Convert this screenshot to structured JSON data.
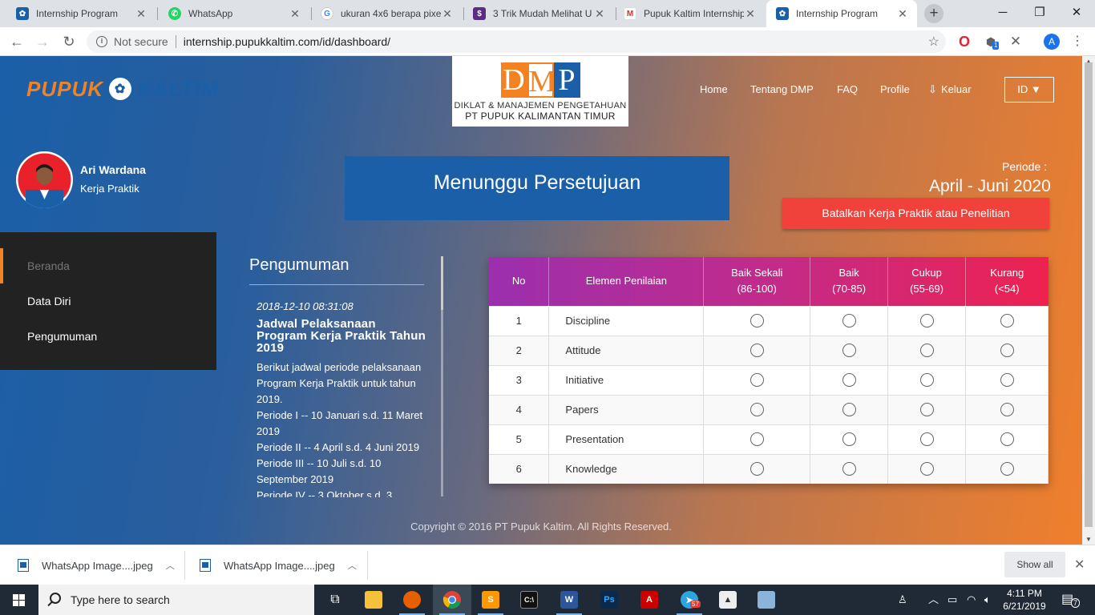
{
  "browser": {
    "tabs": [
      {
        "title": "Internship Program",
        "icon": "pupuk-kaltim-favicon",
        "color": "#1a5fa8"
      },
      {
        "title": "WhatsApp",
        "icon": "whatsapp-favicon",
        "color": "#25d366"
      },
      {
        "title": "ukuran 4x6 berapa pixe",
        "icon": "google-favicon",
        "color": "#4285f4"
      },
      {
        "title": "3 Trik Mudah Melihat U",
        "icon": "dollar-favicon",
        "color": "#5b2c82"
      },
      {
        "title": "Pupuk Kaltim Internship",
        "icon": "gmail-favicon",
        "color": "#d93025"
      },
      {
        "title": "Internship Program",
        "icon": "pupuk-kaltim-favicon",
        "color": "#1a5fa8"
      }
    ],
    "security_label": "Not secure",
    "url": "internship.pupukkaltim.com/id/dashboard/",
    "profile_initial": "A",
    "ext_badge": "1"
  },
  "site": {
    "logo_left": "PUPUK",
    "logo_right": "KALTIM",
    "dmp_letters": [
      "D",
      "M",
      "P"
    ],
    "dmp_line1": "DIKLAT & MANAJEMEN PENGETAHUAN",
    "dmp_line2": "PT PUPUK KALIMANTAN TIMUR",
    "nav": {
      "home": "Home",
      "about": "Tentang DMP",
      "faq": "FAQ",
      "profile": "Profile",
      "logout": "Keluar",
      "lang": "ID ▼"
    },
    "brand_orange": "#f58220",
    "brand_blue": "#1a5fa8"
  },
  "user": {
    "name": "Ari Wardana",
    "role": "Kerja Praktik"
  },
  "status": {
    "title": "Menunggu Persetujuan",
    "periode_label": "Periode :",
    "periode_value": "April - Juni 2020",
    "cancel_label": "Batalkan Kerja Praktik atau Penelitian"
  },
  "sidebar": {
    "items": [
      {
        "label": "Beranda",
        "active": true
      },
      {
        "label": "Data Diri",
        "active": false
      },
      {
        "label": "Pengumuman",
        "active": false
      }
    ]
  },
  "announcement": {
    "section_title": "Pengumuman",
    "date": "2018-12-10 08:31:08",
    "title": "Jadwal Pelaksanaan Program Kerja Praktik Tahun 2019",
    "body": [
      "Berikut jadwal periode pelaksanaan Program Kerja Praktik untuk tahun 2019.",
      "Periode I -- 10 Januari s.d. 11 Maret 2019",
      "Periode II -- 4 April s.d. 4 Juni 2019",
      "Periode III -- 10 Juli s.d. 10 September 2019",
      "Periode IV -- 3 Oktober s.d. 3"
    ]
  },
  "evaluation": {
    "headers": {
      "no": "No",
      "element": "Elemen Penilaian",
      "options": [
        {
          "name": "Baik Sekali",
          "range": "(86-100)"
        },
        {
          "name": "Baik",
          "range": "(70-85)"
        },
        {
          "name": "Cukup",
          "range": "(55-69)"
        },
        {
          "name": "Kurang",
          "range": "(<54)"
        }
      ]
    },
    "rows": [
      {
        "no": "1",
        "element": "Discipline"
      },
      {
        "no": "2",
        "element": "Attitude"
      },
      {
        "no": "3",
        "element": "Initiative"
      },
      {
        "no": "4",
        "element": "Papers"
      },
      {
        "no": "5",
        "element": "Presentation"
      },
      {
        "no": "6",
        "element": "Knowledge"
      }
    ]
  },
  "footer": {
    "copyright": "Copyright © 2016 PT Pupuk Kaltim. All Rights Reserved."
  },
  "downloads": {
    "items": [
      "WhatsApp Image....jpeg",
      "WhatsApp Image....jpeg"
    ],
    "show_all": "Show all"
  },
  "taskbar": {
    "search_placeholder": "Type here to search",
    "time": "4:11 PM",
    "date": "6/21/2019",
    "notification_count": "7",
    "telegram_badge": "57"
  }
}
